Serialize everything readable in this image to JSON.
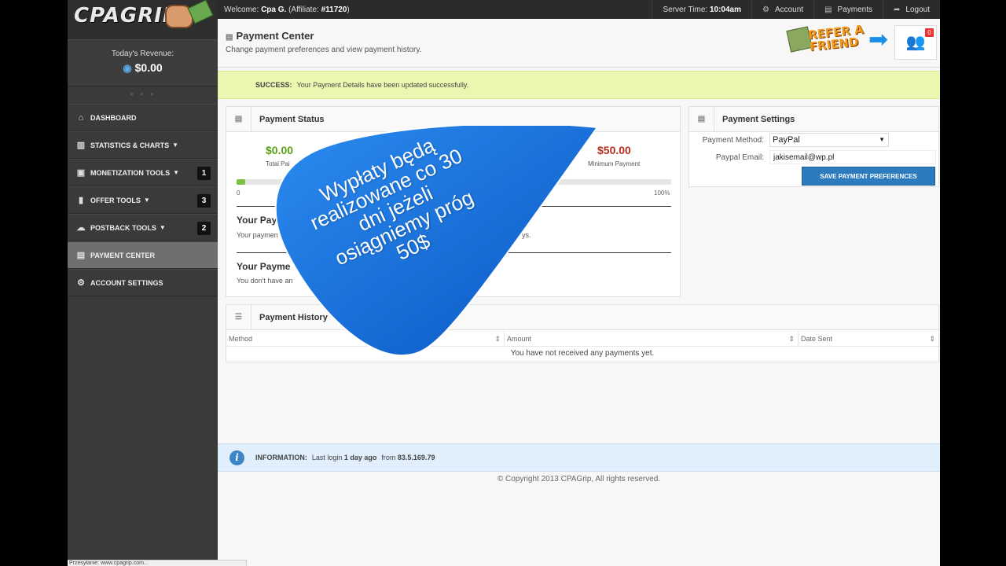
{
  "sidebar": {
    "logo": {
      "brand": "CPAGRIP"
    },
    "revenue": {
      "label": "Today's Revenue:",
      "value": "$0.00"
    },
    "items": [
      {
        "label": "DASHBOARD",
        "icon": "home-icon"
      },
      {
        "label": "STATISTICS & CHARTS",
        "icon": "bar-chart-icon",
        "caret": true
      },
      {
        "label": "MONETIZATION TOOLS",
        "icon": "tools-icon",
        "caret": true,
        "badge": "1"
      },
      {
        "label": "OFFER TOOLS",
        "icon": "briefcase-icon",
        "caret": true,
        "badge": "3"
      },
      {
        "label": "POSTBACK TOOLS",
        "icon": "cloud-icon",
        "caret": true,
        "badge": "2"
      },
      {
        "label": "PAYMENT CENTER",
        "icon": "money-icon",
        "active": true
      },
      {
        "label": "ACCOUNT SETTINGS",
        "icon": "gear-icon"
      }
    ]
  },
  "topbar": {
    "welcome_prefix": "Welcome:",
    "user": "Cpa G.",
    "affiliate_prefix": "(Affiliate:",
    "affiliate_id": "#11720",
    "affiliate_suffix": ")",
    "server_time_label": "Server Time:",
    "server_time": "10:04am",
    "account": "Account",
    "payments": "Payments",
    "logout": "Logout"
  },
  "header": {
    "title": "Payment Center",
    "subtitle": "Change payment preferences and view payment history.",
    "refer_line1": "REFER A",
    "refer_line2": "FRIEND",
    "friends_count": "0"
  },
  "success": {
    "label": "SUCCESS:",
    "text": "Your Payment Details have been updated successfully."
  },
  "payment_status": {
    "title": "Payment Status",
    "total_paid": "$0.00",
    "total_paid_label": "Total Pai",
    "minimum": "$50.00",
    "minimum_label": "Minimum Payment",
    "progress": 0,
    "pct_start": "0",
    "pct_end": "100%",
    "sec1_title": "Your Paym",
    "sec1_text": "Your paymen",
    "sec1_tail": "ys.",
    "sec2_title": "Your Payme",
    "sec2_text": "You don't have an"
  },
  "payment_settings": {
    "title": "Payment Settings",
    "method_label": "Payment Method:",
    "method_value": "PayPal",
    "email_label": "Paypal Email:",
    "email_value": "jakisemail@wp.pl",
    "save_button": "SAVE PAYMENT PREFERENCES"
  },
  "payment_history": {
    "title": "Payment History",
    "columns": [
      "Method",
      "Amount",
      "Date Sent"
    ],
    "empty": "You have not received any payments yet."
  },
  "info": {
    "label": "INFORMATION:",
    "text_prefix": "Last login",
    "ago": "1 day ago",
    "from": "from",
    "ip": "83.5.169.79"
  },
  "copyright": "© Copyright 2013 CPAGrip, All rights reserved.",
  "statusbar": "Przesyłanie: www.cpagrip.com...",
  "overlay": {
    "text": "Wypłaty będą realizowane co 30 dni jeżeli osiągniemy próg 50$",
    "color": "#1a6fd6"
  }
}
